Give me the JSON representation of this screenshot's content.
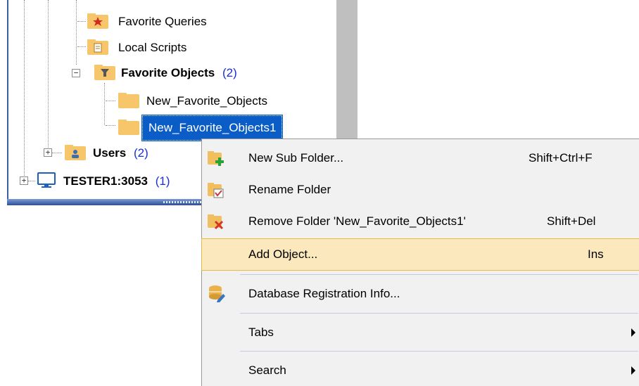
{
  "tree": {
    "nodes": [
      {
        "label": "Favorite Queries"
      },
      {
        "label": "Local Scripts"
      },
      {
        "label": "Favorite Objects",
        "count": "(2)"
      },
      {
        "label": "New_Favorite_Objects"
      },
      {
        "label": "New_Favorite_Objects1"
      },
      {
        "label": "Users",
        "count": "(2)"
      },
      {
        "label": "TESTER1:3053",
        "count": "(1)"
      }
    ]
  },
  "context_menu": {
    "items": [
      {
        "label": "New Sub Folder...",
        "shortcut": "Shift+Ctrl+F",
        "icon": "folder-add-icon"
      },
      {
        "label": "Rename Folder",
        "shortcut": "",
        "icon": "folder-rename-icon"
      },
      {
        "label": "Remove Folder 'New_Favorite_Objects1'",
        "shortcut": "Shift+Del",
        "icon": "folder-remove-icon"
      },
      {
        "label": "Add Object...",
        "shortcut": "Ins",
        "icon": ""
      },
      {
        "label": "Database Registration Info...",
        "shortcut": "",
        "icon": "database-edit-icon"
      },
      {
        "label": "Tabs",
        "shortcut": "",
        "icon": "",
        "submenu": true
      },
      {
        "label": "Search",
        "shortcut": "",
        "icon": "",
        "submenu": true
      }
    ]
  },
  "colors": {
    "selection": "#0a5cc6",
    "menu_highlight": "#fbe9bd",
    "count_text": "#1a2fd4",
    "folder": "#f7c56a"
  }
}
